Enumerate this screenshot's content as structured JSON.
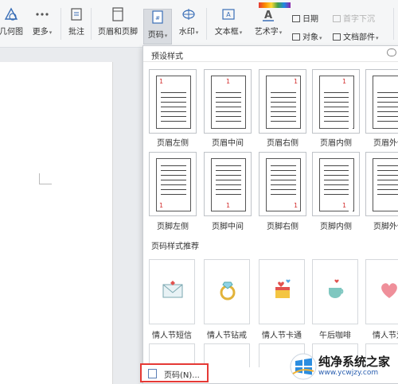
{
  "ribbon": {
    "buttons": [
      {
        "id": "shapes",
        "label": "几何图"
      },
      {
        "id": "more",
        "label": "更多"
      },
      {
        "id": "comment",
        "label": "批注"
      },
      {
        "id": "header_footer",
        "label": "页眉和页脚"
      },
      {
        "id": "page_number",
        "label": "页码"
      },
      {
        "id": "watermark",
        "label": "水印"
      },
      {
        "id": "textbox",
        "label": "文本框"
      },
      {
        "id": "wordart",
        "label": "艺术字"
      }
    ],
    "small_items": {
      "date": "日期",
      "object": "对象",
      "doc_parts": "文档部件",
      "first_drop": "首字下沉"
    }
  },
  "panel": {
    "preset_title": "预设样式",
    "header_presets": [
      {
        "label": "页眉左侧",
        "num": "1"
      },
      {
        "label": "页眉中间",
        "num": "1"
      },
      {
        "label": "页眉右侧",
        "num": "1"
      },
      {
        "label": "页眉内侧",
        "num": "1"
      },
      {
        "label": "页眉外侧",
        "num": "1"
      }
    ],
    "footer_presets": [
      {
        "label": "页脚左侧",
        "num": "1"
      },
      {
        "label": "页脚中间",
        "num": "1"
      },
      {
        "label": "页脚右侧",
        "num": "1"
      },
      {
        "label": "页脚内侧",
        "num": "1"
      },
      {
        "label": "页脚外侧",
        "num": "1"
      }
    ],
    "recommend_title": "页码样式推荐",
    "recommend": [
      {
        "label": "情人节短信",
        "icon": "envelope-heart"
      },
      {
        "label": "情人节钻戒",
        "icon": "diamond-ring"
      },
      {
        "label": "情人节卡通",
        "icon": "gift-hearts"
      },
      {
        "label": "午后咖啡",
        "icon": "coffee-cup"
      },
      {
        "label": "情人节爱",
        "icon": "heart"
      }
    ],
    "page_number_item": "页码(N)..."
  },
  "watermark_logo": {
    "title": "纯净系统之家",
    "url": "www.ycwjzy.com"
  }
}
